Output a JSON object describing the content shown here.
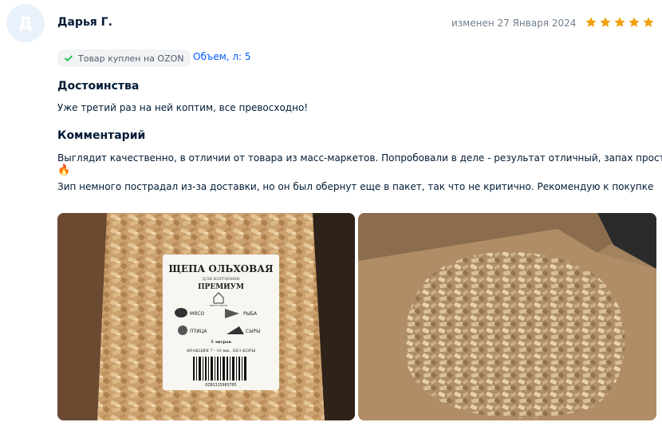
{
  "review": {
    "avatar_letter": "Д",
    "author": "Дарья Г.",
    "date": "изменен 27 Января 2024",
    "rating": 5,
    "rating_color": "#f1a10d",
    "verified_label": "Товар куплен на OZON",
    "variant_label": "Объем, л: 5",
    "pros_title": "Достоинства",
    "pros_text": "Уже третий раз на ней коптим, все превосходно!",
    "comment_title": "Комментарий",
    "comment_line1": "Выглядит качественно, в отличии от товара из масс-маркетов. Попробовали в деле - результат отличный, запах просто",
    "comment_emoji": "🔥",
    "comment_line2": "Зип немного пострадал из-за доставки, но он был обернут еще в пакет, так что не критично. Рекомендую к покупке"
  },
  "photos": [
    {
      "label": {
        "title": "ЩЕПА ОЛЬХОВАЯ",
        "subtitle": "ДЛЯ КОПЧЕНИЯ",
        "grade": "ПРЕМИУМ",
        "brand": "PROFIT HOUSE",
        "item1": "МЯСО",
        "item2": "РЫБА",
        "item3": "ПТИЦА",
        "item4": "СЫРЫ",
        "volume": "5 литров",
        "fraction": "ФРАКЦИЯ 7 - 10 мм., БЕЗ КОРЫ",
        "code": "OZN1315983705"
      }
    },
    {}
  ]
}
